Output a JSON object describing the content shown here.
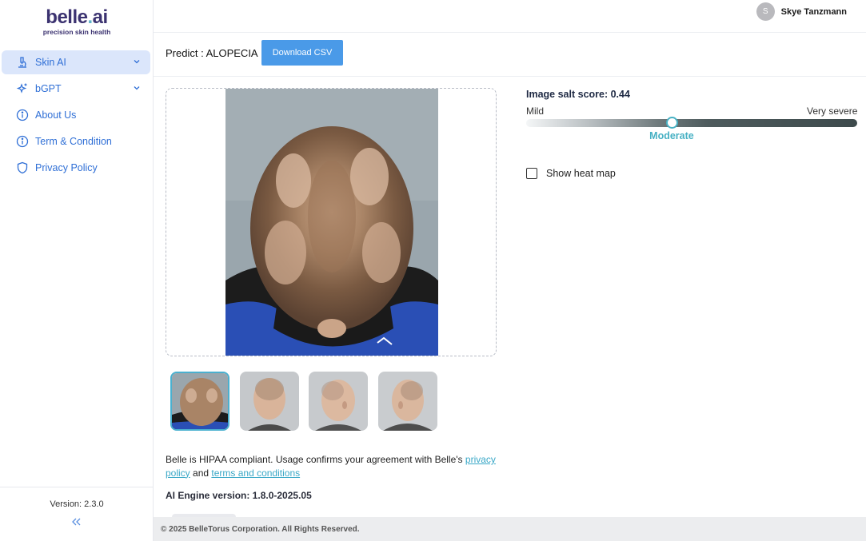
{
  "brand": {
    "name_part1": "belle",
    "name_dot": ".",
    "name_part2": "ai",
    "tagline": "precision skin health",
    "accent": "#5fb4c9",
    "primary": "#3b3270"
  },
  "sidebar": {
    "items": [
      {
        "label": "Skin AI",
        "icon": "microscope-icon",
        "active": true,
        "expandable": true
      },
      {
        "label": "bGPT",
        "icon": "sparkle-icon",
        "active": false,
        "expandable": true
      },
      {
        "label": "About Us",
        "icon": "info-icon",
        "active": false,
        "expandable": false
      },
      {
        "label": "Term & Condition",
        "icon": "info-icon",
        "active": false,
        "expandable": false
      },
      {
        "label": "Privacy Policy",
        "icon": "shield-icon",
        "active": false,
        "expandable": false
      }
    ],
    "version": "Version: 2.3.0",
    "collapse_icon": "double-chevron-left-icon"
  },
  "header": {
    "user_initial": "S",
    "user_name": "Skye Tanzmann"
  },
  "predict": {
    "label": "Predict : ALOPECIA",
    "download_button": "Download CSV"
  },
  "gallery": {
    "selected_index": 0,
    "thumbnail_count": 4
  },
  "score": {
    "title": "Image salt score: 0.44",
    "value": 0.44,
    "min_label": "Mild",
    "max_label": "Very severe",
    "level_label": "Moderate"
  },
  "heatmap": {
    "label": "Show heat map",
    "checked": false
  },
  "notice": {
    "text_prefix": "Belle is HIPAA compliant. Usage confirms your agreement with Belle's ",
    "privacy_link": "privacy policy",
    "and_text": " and ",
    "terms_link": "terms and conditions"
  },
  "engine": {
    "label": "AI Engine version: 1.8.0-2025.05"
  },
  "footer": {
    "copyright": "© 2025 BelleTorus Corporation. All Rights Reserved."
  },
  "colors": {
    "nav_text": "#2f6fd6",
    "nav_active_bg": "#dbe6fb",
    "button_blue": "#4a9ae8",
    "score_accent": "#48b1c4"
  }
}
